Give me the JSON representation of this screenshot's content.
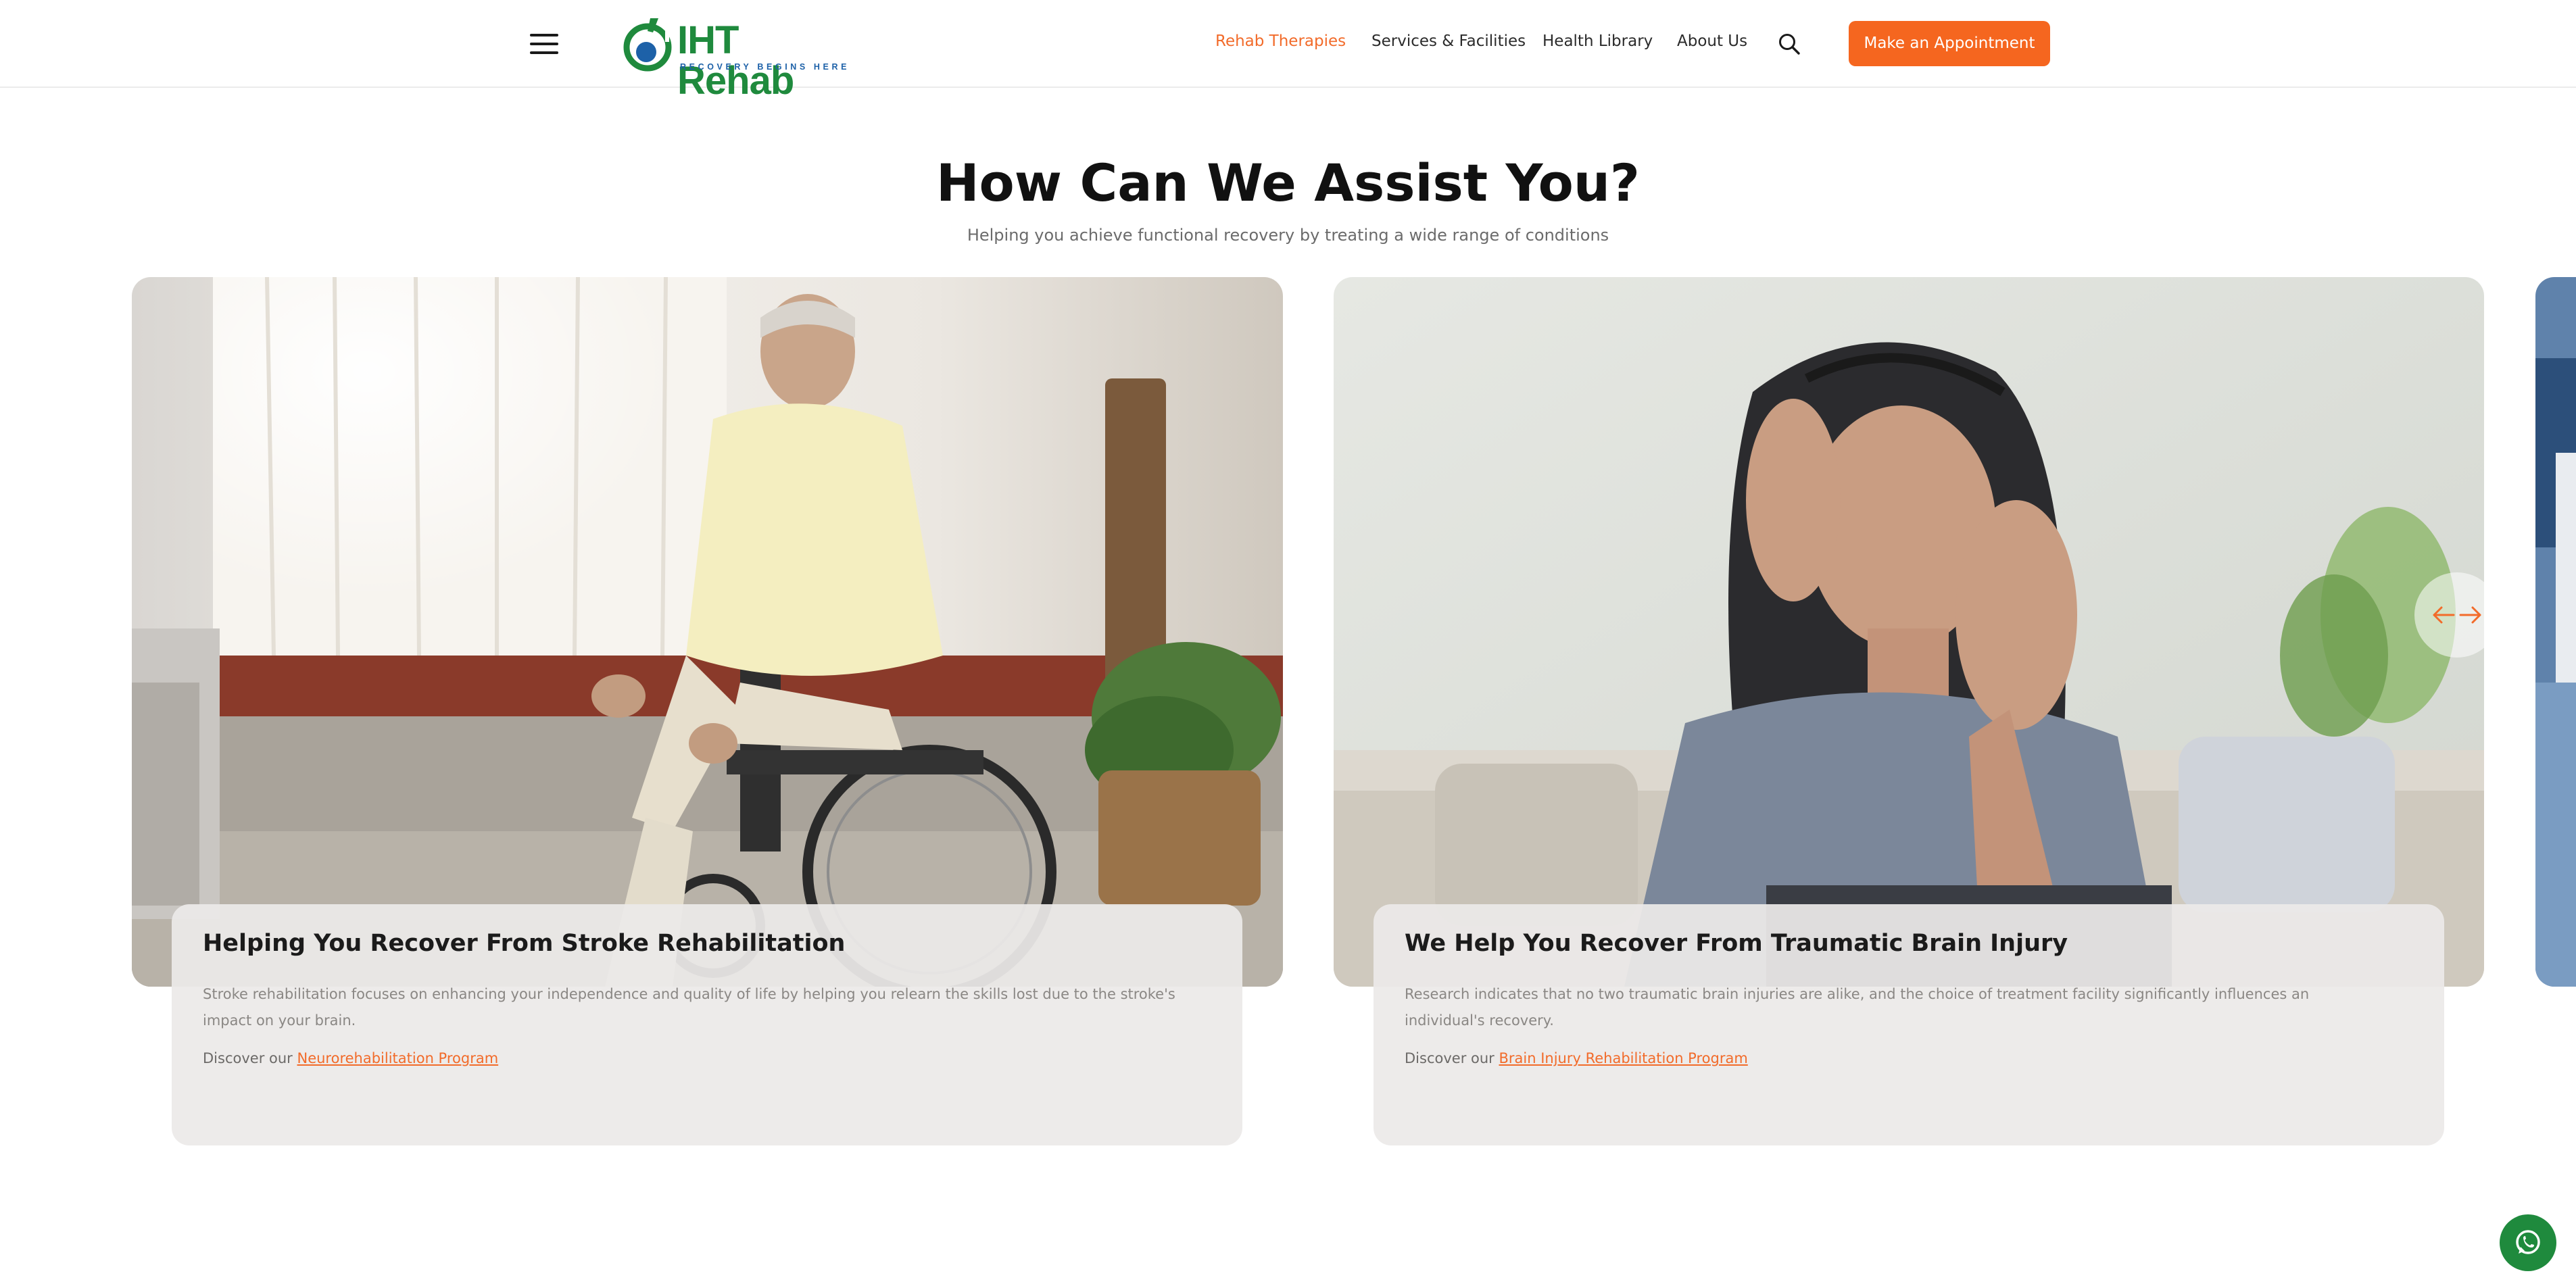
{
  "header": {
    "logo": {
      "name": "IHT Rehab",
      "tagline": "RECOVERY BEGINS HERE"
    },
    "nav": [
      {
        "label": "Rehab Therapies",
        "active": true
      },
      {
        "label": "Services & Facilities",
        "active": false
      },
      {
        "label": "Health Library",
        "active": false
      },
      {
        "label": "About Us",
        "active": false
      }
    ],
    "cta_label": "Make an Appointment"
  },
  "main": {
    "title": "How Can We Assist You?",
    "subtitle": "Helping you achieve functional recovery by treating a wide range of conditions"
  },
  "cards": [
    {
      "title": "Helping You Recover From Stroke Rehabilitation",
      "description": "Stroke rehabilitation focuses on enhancing your independence and quality of life by helping you relearn the skills lost due to the stroke's impact on your brain.",
      "discover_prefix": "Discover our",
      "link_label": "Neurorehabilitation Program"
    },
    {
      "title": "We Help You Recover From Traumatic Brain Injury",
      "description": "Research indicates that no two traumatic brain injuries are alike, and the choice of treatment facility significantly influences an individual's recovery.",
      "discover_prefix": "Discover our",
      "link_label": "Brain Injury Rehabilitation Program"
    }
  ],
  "icons": {
    "menu": "hamburger-menu-icon",
    "search": "search-icon",
    "prev": "arrow-left-icon",
    "next": "arrow-right-icon",
    "chat": "whatsapp-icon"
  },
  "colors": {
    "accent": "#f5661f",
    "brand_green": "#1f8a3d",
    "brand_blue": "#1d61a8"
  }
}
